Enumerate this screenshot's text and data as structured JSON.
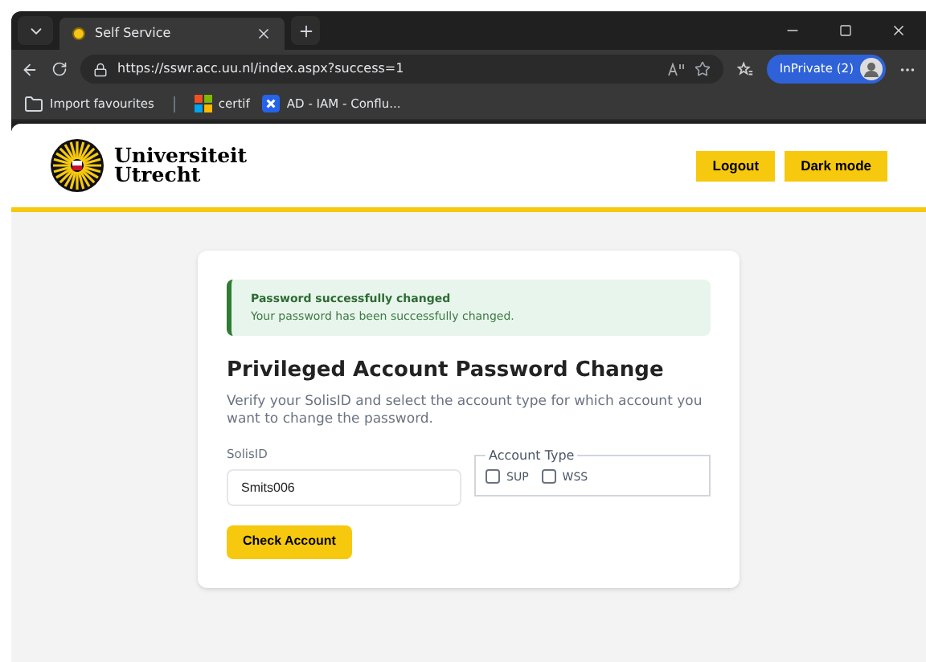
{
  "browser": {
    "tab_title": "Self Service",
    "url": "https://sswr.acc.uu.nl/index.aspx?success=1",
    "profile": "InPrivate (2)",
    "bookmarks": [
      {
        "label": "Import favourites",
        "kind": "folder"
      },
      {
        "label": "certif",
        "kind": "tiles"
      },
      {
        "label": "AD - IAM - Conflu...",
        "kind": "confluence"
      }
    ]
  },
  "header": {
    "logo_line_1": "Universiteit",
    "logo_line_2": "Utrecht",
    "buttons": [
      "Logout",
      "Dark mode"
    ]
  },
  "alert": {
    "title": "Password successfully changed",
    "message": "Your password has been successfully changed."
  },
  "form": {
    "title": "Privileged Account Password Change",
    "description": "Verify your SolisID and select the account type for which account you want to change the password.",
    "field_label": "SolisID",
    "field_value": "Smits006",
    "account_type_legend": "Account Type",
    "account_types": [
      {
        "label": "SUP",
        "checked": false
      },
      {
        "label": "WSS",
        "checked": false
      }
    ],
    "submit": "Check Account"
  }
}
